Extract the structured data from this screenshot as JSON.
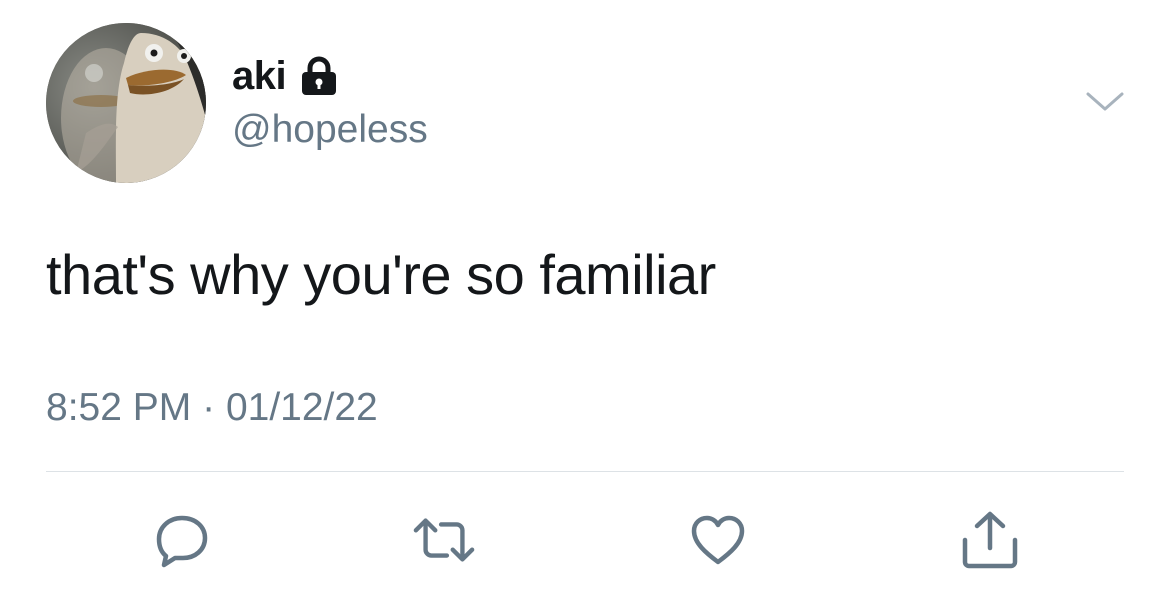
{
  "author": {
    "display_name": "aki",
    "handle": "@hopeless",
    "protected": true,
    "avatar_icon": "penguin-avatar"
  },
  "tweet": {
    "text": "that's why you're so familiar"
  },
  "meta": {
    "time": "8:52 PM",
    "separator": "·",
    "date": "01/12/22"
  },
  "actions": [
    "reply-icon",
    "retweet-icon",
    "like-icon",
    "share-icon"
  ],
  "colors": {
    "text": "#14171a",
    "secondary": "#657786",
    "divider": "#dde2e6",
    "icon": "#657786"
  }
}
